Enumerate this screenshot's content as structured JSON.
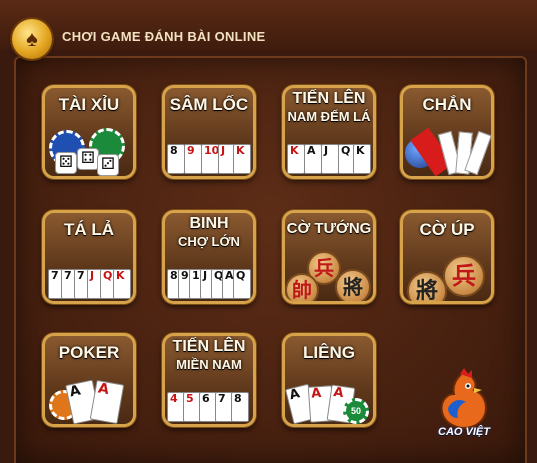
{
  "header": {
    "title": "CHƠI GAME ĐÁNH BÀI ONLINE",
    "logo_icon": "spade-coin-icon",
    "logo_glyph": "♠"
  },
  "games": [
    {
      "line1": "TÀI XỈU"
    },
    {
      "line1": "SÂM LỐC",
      "cards": [
        "8",
        "9",
        "10",
        "J",
        "K"
      ]
    },
    {
      "line1": "TIẾN LÊN",
      "line2": "NAM ĐẾM LÁ",
      "cards": [
        "K",
        "A",
        "J",
        "Q",
        "K"
      ]
    },
    {
      "line1": "CHẮN"
    },
    {
      "line1": "TÁ LẢ",
      "cards": [
        "7",
        "7",
        "7",
        "J",
        "Q",
        "K"
      ]
    },
    {
      "line1": "BINH",
      "line2": "CHỢ LỚN",
      "cards": [
        "8",
        "9",
        "10",
        "J",
        "Q",
        "A",
        "Q"
      ]
    },
    {
      "line1": "CỜ TƯỚNG",
      "pieces": [
        "兵",
        "帥",
        "將"
      ]
    },
    {
      "line1": "CỜ ÚP",
      "pieces": [
        "兵",
        "將"
      ]
    },
    {
      "line1": "POKER",
      "cards": [
        "A",
        "A"
      ]
    },
    {
      "line1": "TIẾN LÊN",
      "line2": "MIỀN NAM",
      "cards": [
        "4",
        "5",
        "6",
        "7",
        "8"
      ]
    },
    {
      "line1": "LIÊNG",
      "cards": [
        "A",
        "A",
        "A"
      ],
      "chip_value": "50"
    }
  ],
  "brand": {
    "name": "CAO VIỆT",
    "icon": "rooster-mascot-icon"
  }
}
